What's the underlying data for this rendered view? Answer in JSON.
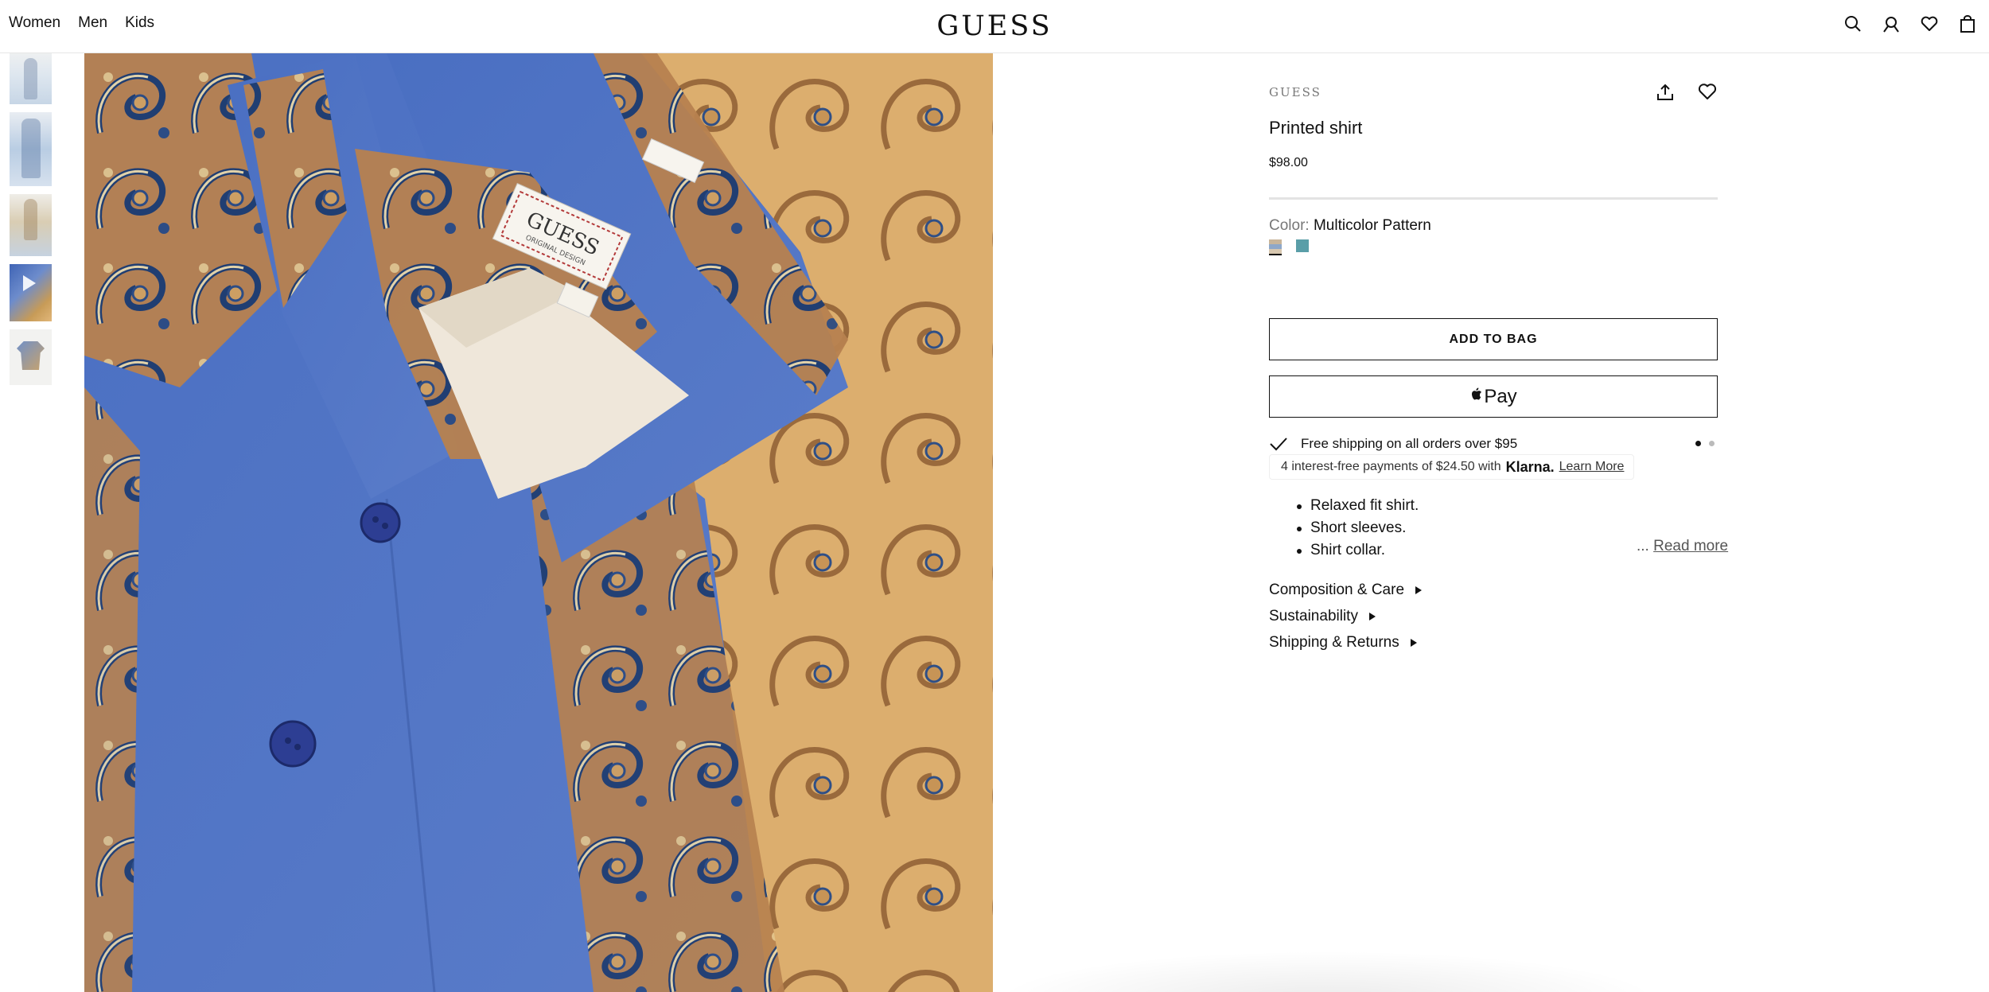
{
  "header": {
    "nav": [
      "Women",
      "Men",
      "Kids"
    ],
    "logo": "GUESS",
    "icons": [
      "search-icon",
      "account-icon",
      "wishlist-icon",
      "bag-icon"
    ]
  },
  "gallery": {
    "thumbnails": [
      "thumbnail-1",
      "thumbnail-2",
      "thumbnail-3",
      "thumbnail-video",
      "thumbnail-5"
    ],
    "main_image_alt": "Printed shirt close-up"
  },
  "product": {
    "brand": "GUESS",
    "title": "Printed shirt",
    "price": "$98.00",
    "color_label": "Color:",
    "color_value": "Multicolor Pattern",
    "swatch_colors": [
      "#c9b59a",
      "#5a9ea8"
    ],
    "add_to_bag": "ADD TO BAG",
    "apple_pay_label": "Pay",
    "promo": "Free shipping on all orders over $95",
    "klarna": {
      "text": "4 interest-free payments of $24.50 with",
      "logo": "Klarna.",
      "link": "Learn More"
    },
    "bullets": [
      "Relaxed fit shirt.",
      "Short sleeves.",
      "Shirt collar."
    ],
    "read_more_prefix": "...",
    "read_more": "Read more",
    "accordions": [
      "Composition & Care",
      "Sustainability",
      "Shipping & Returns"
    ]
  }
}
